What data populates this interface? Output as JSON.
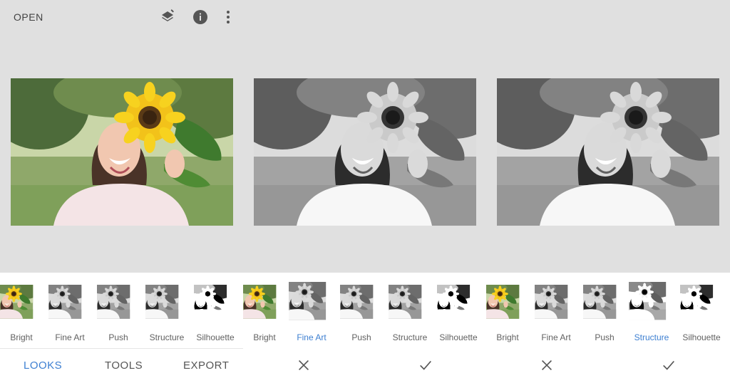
{
  "toolbar": {
    "open_label": "OPEN",
    "icons": [
      "layers-refresh-icon",
      "info-icon",
      "more-vert-icon"
    ]
  },
  "photos": [
    {
      "style": "original"
    },
    {
      "style": "Fine Art"
    },
    {
      "style": "Structure"
    }
  ],
  "looks_panels": [
    {
      "items": [
        "Bright",
        "Fine Art",
        "Push",
        "Structure",
        "Silhouette"
      ],
      "selected": null
    },
    {
      "items": [
        "Bright",
        "Fine Art",
        "Push",
        "Structure",
        "Silhouette"
      ],
      "selected": "Fine Art"
    },
    {
      "items": [
        "Bright",
        "Fine Art",
        "Push",
        "Structure",
        "Silhouette"
      ],
      "selected": "Structure"
    }
  ],
  "tabs": {
    "looks": "LOOKS",
    "tools": "TOOLS",
    "export": "EXPORT",
    "active": "LOOKS"
  },
  "actions": [
    "cancel-icon",
    "apply-check-icon",
    "cancel-icon",
    "apply-check-icon"
  ],
  "colors": {
    "accent": "#3d7fd1",
    "background": "#e0e0e0",
    "panel": "#ffffff"
  }
}
